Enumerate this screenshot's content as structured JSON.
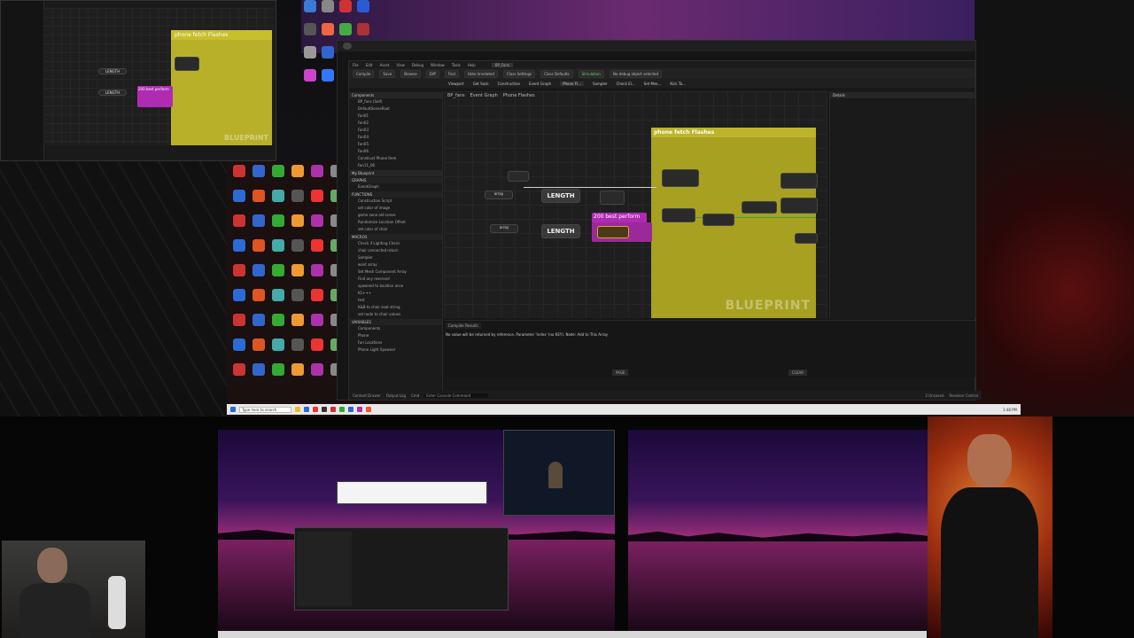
{
  "top_small_window": {
    "bp_title": "phone fetch Flashes",
    "magenta_label": "200 best perform",
    "len1": "LENGTH",
    "len2": "LENGTH",
    "watermark": "BLUEPRINT"
  },
  "main_window": {
    "outer_title": "",
    "tab": "BP_Fans",
    "tab2": "BL_Phone_Light",
    "menu": [
      "File",
      "Edit",
      "Asset",
      "View",
      "Debug",
      "Window",
      "Tools",
      "Help"
    ],
    "toolbar": [
      "Compile",
      "Save",
      "Browse",
      "Diff",
      "Find",
      "Hide Unrelated",
      "Class Settings",
      "Class Defaults",
      "Simulation",
      "No debug object selected"
    ],
    "graph_tabs": [
      "Viewport",
      "Get Sock",
      "Construction",
      "Event Graph",
      "Phone Fl...",
      "Sampler",
      "Check El...",
      "Set Mes...",
      "Kick Ta..."
    ],
    "breadcrumb": [
      "BP_fans",
      "Event Graph",
      "Phone Flashes"
    ],
    "components_header": "Components",
    "components": [
      "BP_fans (Self)",
      "DefaultSceneRoot",
      "Fan01",
      "Fan02",
      "Fan03",
      "Fan04",
      "Fan05",
      "Fan06",
      "Construct Phone Item",
      "Fan11_06"
    ],
    "my_blueprint_header": "My Blueprint",
    "graphs_header": "GRAPHS",
    "graphs": [
      "EventGraph"
    ],
    "functions_header": "FUNCTIONS",
    "functions": [
      "Construction Script",
      "set color of image",
      "game zone old scene",
      "Randomize Location Offset",
      "set color of chair"
    ],
    "macros_header": "MACROS",
    "macros": [
      "Check if Lighting Chairs",
      "chair connected return",
      "Sampler",
      "want array",
      "Set Mesh Component Array",
      "Find any reserved",
      "spawned to location once",
      "K1+++",
      "test",
      "K&B to chair seat string",
      "set node to chair values"
    ],
    "variables_header": "VARIABLES",
    "variables": [
      "Components",
      "Phone",
      "Fan Locations",
      "Phone Light Spawner"
    ],
    "bp_title": "phone fetch Flashes",
    "magenta_label": "200 best perform",
    "len1": "LENGTH",
    "len2": "LENGTH",
    "watermark": "BLUEPRINT",
    "details_header": "Details",
    "compiler_header": "Compiler Results",
    "compiler_msg": "No value will be returned by reference. Parameter 'Index' (no KEY). Node: Add to This Array",
    "clear_label": "CLEAR",
    "page_label": "PAGE",
    "status": [
      "Content Drawer",
      "Output Log",
      "Cmd",
      "Enter Console Command"
    ],
    "status_right": [
      "2 Unsaved",
      "Revision Control"
    ]
  },
  "taskbar": {
    "search": "Type here to search",
    "time": "1:48 PM"
  },
  "colors": {
    "blueprint_yellow": "#a7a021",
    "magenta_node": "#b02ab4",
    "wire_green": "#5ad05a"
  }
}
